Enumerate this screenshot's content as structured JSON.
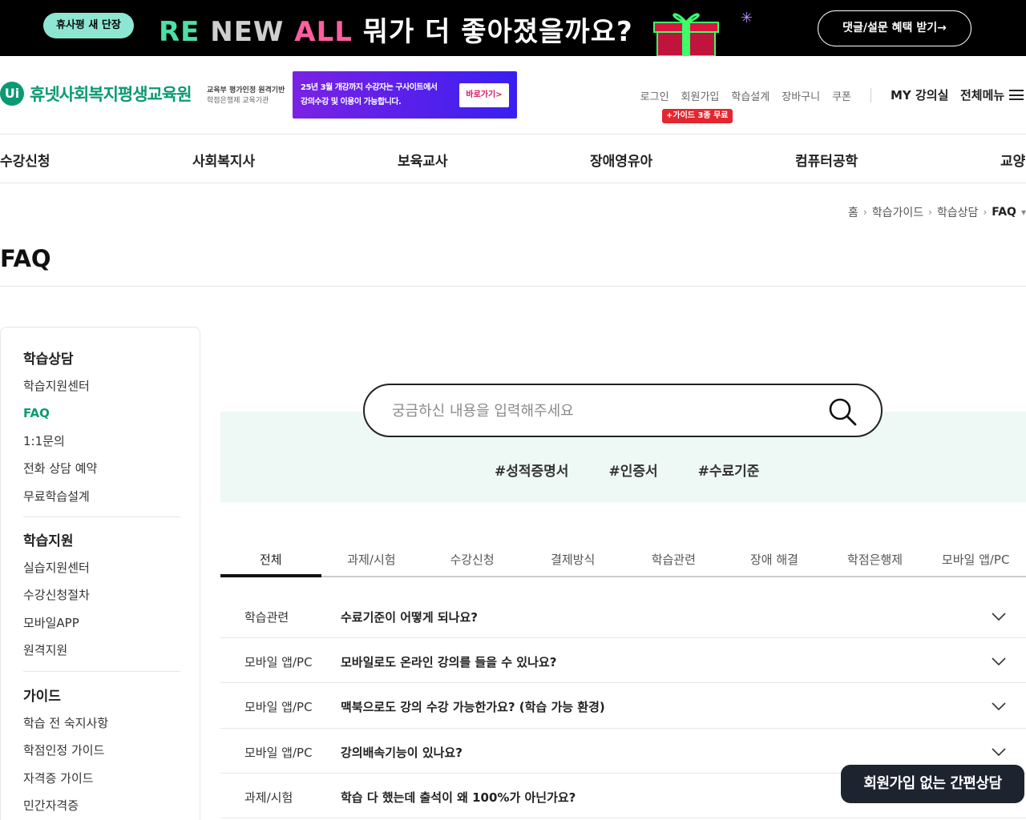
{
  "promo": {
    "badge_prefix": "휴사평",
    "badge_bold": "새 단장",
    "title_re": "RE",
    "title_new": "NEW",
    "title_all": "ALL",
    "title_rest": "뭐가 더 좋아졌을까요?",
    "button_label": "댓글/설문 혜택 받기→"
  },
  "header": {
    "logo_mark": "Ui",
    "logo_text": "휴넷사회복지평생교육원",
    "logo_sub_1": "교육부 평가인정 원격기반",
    "logo_sub_2": "학점은행제 교육기관",
    "ad_line1": "25년 3월 개강까지 수강자는 구사이트에서",
    "ad_line2": "강의수강 및 이용이 가능합니다.",
    "ad_button": "바로가기>",
    "util_links": [
      "로그인",
      "회원가입",
      "학습설계",
      "장바구니",
      "쿠폰"
    ],
    "util_badge": "+가이드 3종 무료",
    "my_class": "MY 강의실",
    "all_menu": "전체메뉴"
  },
  "gnb": [
    "수강신청",
    "사회복지사",
    "보육교사",
    "장애영유아",
    "컴퓨터공학",
    "교양"
  ],
  "breadcrumb": [
    "홈",
    "학습가이드",
    "학습상담",
    "FAQ"
  ],
  "page_title": "FAQ",
  "sidebar": {
    "groups": [
      {
        "title": "학습상담",
        "items": [
          "학습지원센터",
          "FAQ",
          "1:1문의",
          "전화 상담 예약",
          "무료학습설계"
        ]
      },
      {
        "title": "학습지원",
        "items": [
          "실습지원센터",
          "수강신청절차",
          "모바일APP",
          "원격지원"
        ]
      },
      {
        "title": "가이드",
        "items": [
          "학습 전 숙지사항",
          "학점인정 가이드",
          "자격증 가이드",
          "민간자격증"
        ]
      }
    ]
  },
  "search": {
    "placeholder": "궁금하신 내용을 입력해주세요",
    "tags": [
      "#성적증명서",
      "#인증서",
      "#수료기준"
    ]
  },
  "tabs": [
    "전체",
    "과제/시험",
    "수강신청",
    "결제방식",
    "학습관련",
    "장애 해결",
    "학점은행제",
    "모바일 앱/PC"
  ],
  "faq": [
    {
      "category": "학습관련",
      "question": "수료기준이 어떻게 되나요?"
    },
    {
      "category": "모바일 앱/PC",
      "question": "모바일로도 온라인 강의를 들을 수 있나요?"
    },
    {
      "category": "모바일 앱/PC",
      "question": "맥북으로도 강의 수강 가능한가요? (학습 가능 환경)"
    },
    {
      "category": "모바일 앱/PC",
      "question": "강의배속기능이 있나요?"
    },
    {
      "category": "과제/시험",
      "question": "학습 다 했는데 출석이 왜 100%가 아닌가요?"
    }
  ],
  "float_button": "회원가입 없는 간편상담",
  "colors": {
    "brand": "#0a9a73",
    "promo_bg": "#000000",
    "ad_purple": "#5a1fe8",
    "search_bg": "#eef8f4"
  }
}
